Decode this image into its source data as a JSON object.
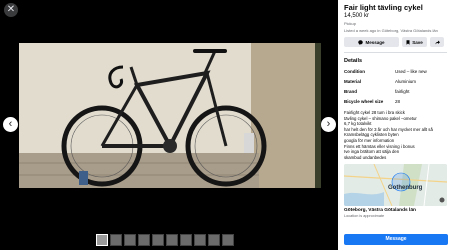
{
  "viewer": {
    "close_glyph": "✕",
    "prev_glyph": "‹",
    "next_glyph": "›",
    "thumbnail_count": 10
  },
  "listing": {
    "title": "Fair light tävling cykel",
    "price": "14,500 kr",
    "pickup": "Pickup",
    "listed": "Listed a week ago in Göteborg, Västra Götalands län",
    "actions": {
      "message_label": "Message",
      "save_label": "Save",
      "message_icon": "messenger-icon",
      "save_icon": "bookmark-icon",
      "share_icon": "share-icon"
    },
    "details_heading": "Details",
    "details": [
      {
        "key": "Condition",
        "value": "Used – like new"
      },
      {
        "key": "Material",
        "value": "Aluminium"
      },
      {
        "key": "Brand",
        "value": "fairlight"
      },
      {
        "key": "Bicycle wheel size",
        "value": "28"
      }
    ],
    "description": [
      "Fairlight cykel 28 tum i bra skick",
      "tävling cykel – shimano pakel –ometur",
      "6,7 kg totalvikt",
      "har helt den för 3 år och har mycket mer allt så",
      "Kramsbelägg cyklisten byten",
      "googla för mer information",
      "Finns ett hämtas eller visning i bonus",
      "Ive inga brältorn att sälja den",
      "skambud undanbedes"
    ],
    "map_label": "Gothenburg",
    "location": "Göteborg, Västra Götalands län",
    "location_sub": "Location is approximate",
    "message_button": "Message"
  },
  "colors": {
    "accent": "#1877f2",
    "panel_bg": "#ffffff",
    "viewer_bg": "#000000"
  }
}
